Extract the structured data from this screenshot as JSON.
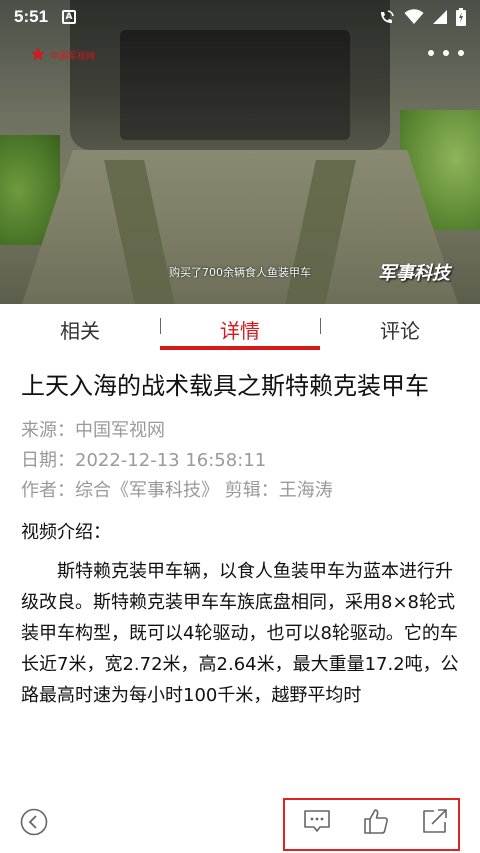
{
  "status_bar": {
    "time": "5:51",
    "notification_icon": "A",
    "icons": [
      "wifi-call-icon",
      "wifi-icon",
      "signal-icon",
      "battery-icon"
    ]
  },
  "video": {
    "logo_text": "中国军视网",
    "subtitle": "购买了700余辆食人鱼装甲车",
    "watermark": "军事科技",
    "more_icon": "more-dots-icon"
  },
  "tabs": [
    {
      "label": "相关",
      "active": false
    },
    {
      "label": "详情",
      "active": true
    },
    {
      "label": "评论",
      "active": false
    }
  ],
  "article": {
    "title": "上天入海的战术载具之斯特赖克装甲车",
    "source": "来源：中国军视网",
    "date": "日期：2022-12-13 16:58:11",
    "author": "作者：综合《军事科技》 剪辑：王海涛",
    "intro_label": "视频介绍：",
    "body": "斯特赖克装甲车辆，以食人鱼装甲车为蓝本进行升级改良。斯特赖克装甲车车族底盘相同，采用8×8轮式装甲车构型，既可以4轮驱动，也可以8轮驱动。它的车长近7米，宽2.72米，高2.64米，最大重量17.2吨，公路最高时速为每小时100千米，越野平均时"
  },
  "bottom_bar": {
    "back_icon": "back-icon",
    "actions": [
      "comment-icon",
      "like-icon",
      "share-icon"
    ]
  },
  "colors": {
    "accent": "#d8191b",
    "highlight_box": "#e0231f",
    "meta_text": "#9a9a9a"
  }
}
